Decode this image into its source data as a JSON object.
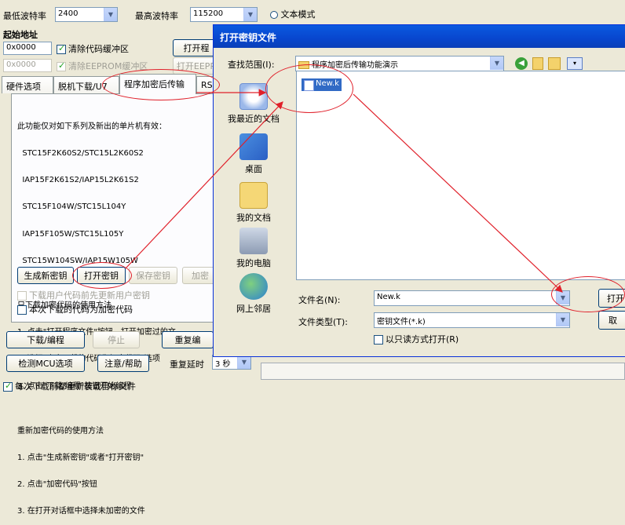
{
  "top_settings": {
    "min_baud_label": "最低波特率",
    "min_baud_value": "2400",
    "max_baud_label": "最高波特率",
    "max_baud_value": "115200",
    "text_mode_label": "文本模式"
  },
  "start_address": {
    "label": "起始地址",
    "code_value": "0x0000",
    "clear_code_label": "清除代码缓冲区",
    "open_prog_button": "打开程",
    "eeprom_value": "0x0000",
    "clear_eeprom_label": "清除EEPROM缓冲区",
    "open_eeprom_button": "打开EEPR"
  },
  "tabs": [
    "硬件选项",
    "脱机下载/U7",
    "程序加密后传输",
    "RS4"
  ],
  "panel": {
    "lines": [
      "此功能仅对如下系列及新出的单片机有效：",
      "  STC15F2K60S2/STC15L2K60S2",
      "  IAP15F2K61S2/IAP15L2K61S2",
      "  STC15F104W/STC15L104Y",
      "  IAP15F105W/STC15L105Y",
      "  STC15W104SW/IAP15W105W",
      "",
      "只下载加密代码的使用方法",
      "1. 点击\"打开程序文件\"按钮，打开加密过的文",
      "2. 选择\"本次下载的代码为加密代码\"选项",
      "3. 点击\"下载/编程\"按钮开始编程",
      "",
      "重新加密代码的使用方法",
      "1. 点击\"生成新密钥\"或者\"打开密钥\"",
      "2. 点击\"加密代码\"按钮",
      "3. 在打开对话框中选择未加密的文件"
    ],
    "gen_key_button": "生成新密钥",
    "open_key_button": "打开密钥",
    "save_key_button": "保存密钥",
    "encrypt_button": "加密",
    "update_key_label": "下载用户代码前先更新用户密钥",
    "encrypted_code_label": "本次下载的代码为加密代码"
  },
  "bottom": {
    "download_button": "下载/编程",
    "stop_button": "停止",
    "repeat_button": "重复编",
    "check_mcu_button": "检测MCU选项",
    "help_button": "注意/帮助",
    "repeat_delay_label": "重复延时",
    "repeat_delay_value": "3 秒",
    "reload_label": "每次下载前都重新装载目标文件"
  },
  "dialog": {
    "title": "打开密钥文件",
    "lookin_label": "查找范围(I):",
    "lookin_value": "程序加密后传输功能演示",
    "places": [
      "我最近的文档",
      "桌面",
      "我的文档",
      "我的电脑",
      "网上邻居"
    ],
    "files": [
      "New.k"
    ],
    "filename_label": "文件名(N):",
    "filename_value": "New.k",
    "filetype_label": "文件类型(T):",
    "filetype_value": "密钥文件(*.k)",
    "readonly_label": "以只读方式打开(R)",
    "open_button": "打开",
    "cancel_button": "取"
  },
  "colors": {
    "annotation": "#e0202a",
    "title_bar": "#0a5ae0",
    "selection": "#316ac5"
  }
}
